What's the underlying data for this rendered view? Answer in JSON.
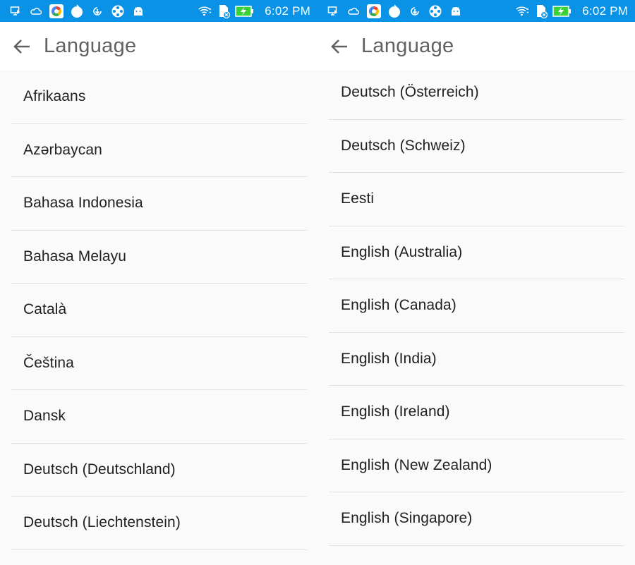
{
  "status_bar": {
    "time": "6:02 PM",
    "accent_color": "#0a92e6",
    "icons": [
      "screen-share-icon",
      "cloud-icon",
      "google-apps-icon",
      "app-circle-icon",
      "download-arrow-icon",
      "film-reel-icon",
      "android-icon",
      "wifi-icon",
      "sd-card-icon",
      "battery-charging-icon"
    ]
  },
  "left": {
    "title": "Language",
    "items": [
      {
        "label": "Afrikaans"
      },
      {
        "label": "Azərbaycan"
      },
      {
        "label": "Bahasa Indonesia"
      },
      {
        "label": "Bahasa Melayu"
      },
      {
        "label": "Català"
      },
      {
        "label": "Čeština"
      },
      {
        "label": "Dansk"
      },
      {
        "label": "Deutsch (Deutschland)"
      },
      {
        "label": "Deutsch (Liechtenstein)"
      }
    ]
  },
  "right": {
    "title": "Language",
    "items": [
      {
        "label": "Deutsch (Österreich)"
      },
      {
        "label": "Deutsch (Schweiz)"
      },
      {
        "label": "Eesti"
      },
      {
        "label": "English (Australia)"
      },
      {
        "label": "English (Canada)"
      },
      {
        "label": "English (India)"
      },
      {
        "label": "English (Ireland)"
      },
      {
        "label": "English (New Zealand)"
      },
      {
        "label": "English (Singapore)"
      }
    ]
  }
}
